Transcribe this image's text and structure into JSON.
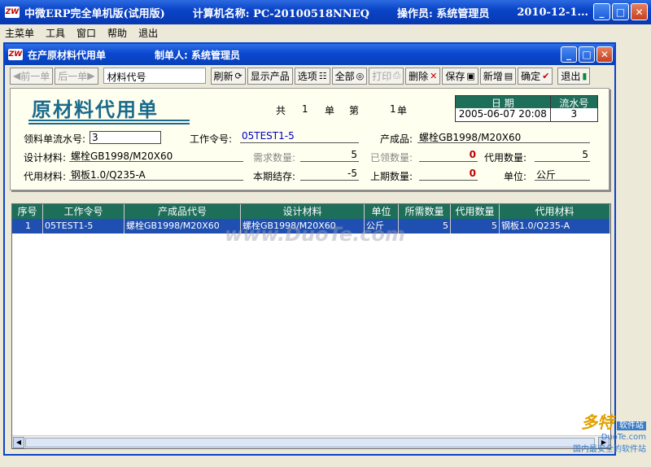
{
  "outer_window": {
    "logo_text": "ZW",
    "app_name": "中微ERP完全单机版(试用版)",
    "computer_name": "计算机名称: PC-20100518NNEQ",
    "operator": "操作员: 系统管理员",
    "date": "2010-12-1..."
  },
  "menu": [
    "主菜单",
    "工具",
    "窗口",
    "帮助",
    "退出"
  ],
  "child_window": {
    "logo_text": "ZW",
    "title": "在产原材料代用单",
    "maker": "制单人: 系统管理员"
  },
  "toolbar": {
    "prev": "前一单",
    "next": "后一单",
    "search_value": "材料代号",
    "refresh": "刷新",
    "show_product": "显示产品",
    "options": "选项",
    "all": "全部",
    "print": "打印",
    "delete": "删除",
    "save": "保存",
    "add": "新增",
    "confirm": "确定",
    "exit": "退出"
  },
  "form": {
    "doc_title": "原材料代用单",
    "pager_total_label": "共",
    "pager_total": "1",
    "pager_unit1": "单",
    "pager_page_label": "第",
    "pager_page": "1",
    "pager_unit2": "单",
    "date_header": "日  期",
    "serial_header": "流水号",
    "date_value": "2005-06-07 20:08",
    "serial_value": "3",
    "req_no_label": "领料单流水号:",
    "req_no_value": "3",
    "work_order_label": "工作令号:",
    "work_order_value": "05TEST1-5",
    "product_label": "产成品:",
    "product_value": "螺栓GB1998/M20X60",
    "design_material_label": "设计材料:",
    "design_material_value": "螺栓GB1998/M20X60",
    "required_qty_label": "需求数量:",
    "required_qty_value": "5",
    "received_qty_label": "已领数量:",
    "received_qty_value": "0",
    "substitute_qty_label": "代用数量:",
    "substitute_qty_value": "5",
    "substitute_material_label": "代用材料:",
    "substitute_material_value": "钢板1.0/Q235-A",
    "current_stock_label": "本期结存:",
    "current_stock_value": "-5",
    "prev_qty_label": "上期数量:",
    "prev_qty_value": "0",
    "unit_label": "单位:",
    "unit_value": "公斤"
  },
  "table": {
    "columns": [
      "序号",
      "工作令号",
      "产成品代号",
      "设计材料",
      "单位",
      "所需数量",
      "代用数量",
      "代用材料"
    ],
    "rows": [
      [
        "1",
        "05TEST1-5",
        "螺栓GB1998/M20X60",
        "螺栓GB1998/M20X60",
        "公斤",
        "5",
        "5",
        "钢板1.0/Q235-A"
      ]
    ]
  },
  "watermark": {
    "center": "www.DuoTe.com",
    "corner_big": "多特",
    "corner_tag": "软件站",
    "corner_small": "DuoTe.com",
    "corner_slogan": "国内最安全的软件站"
  },
  "colors": {
    "title_bar": "#0a44c8",
    "header_teal": "#1e6f5a",
    "selected_row": "#1f4fb0",
    "doc_title": "#1a6b8c"
  }
}
